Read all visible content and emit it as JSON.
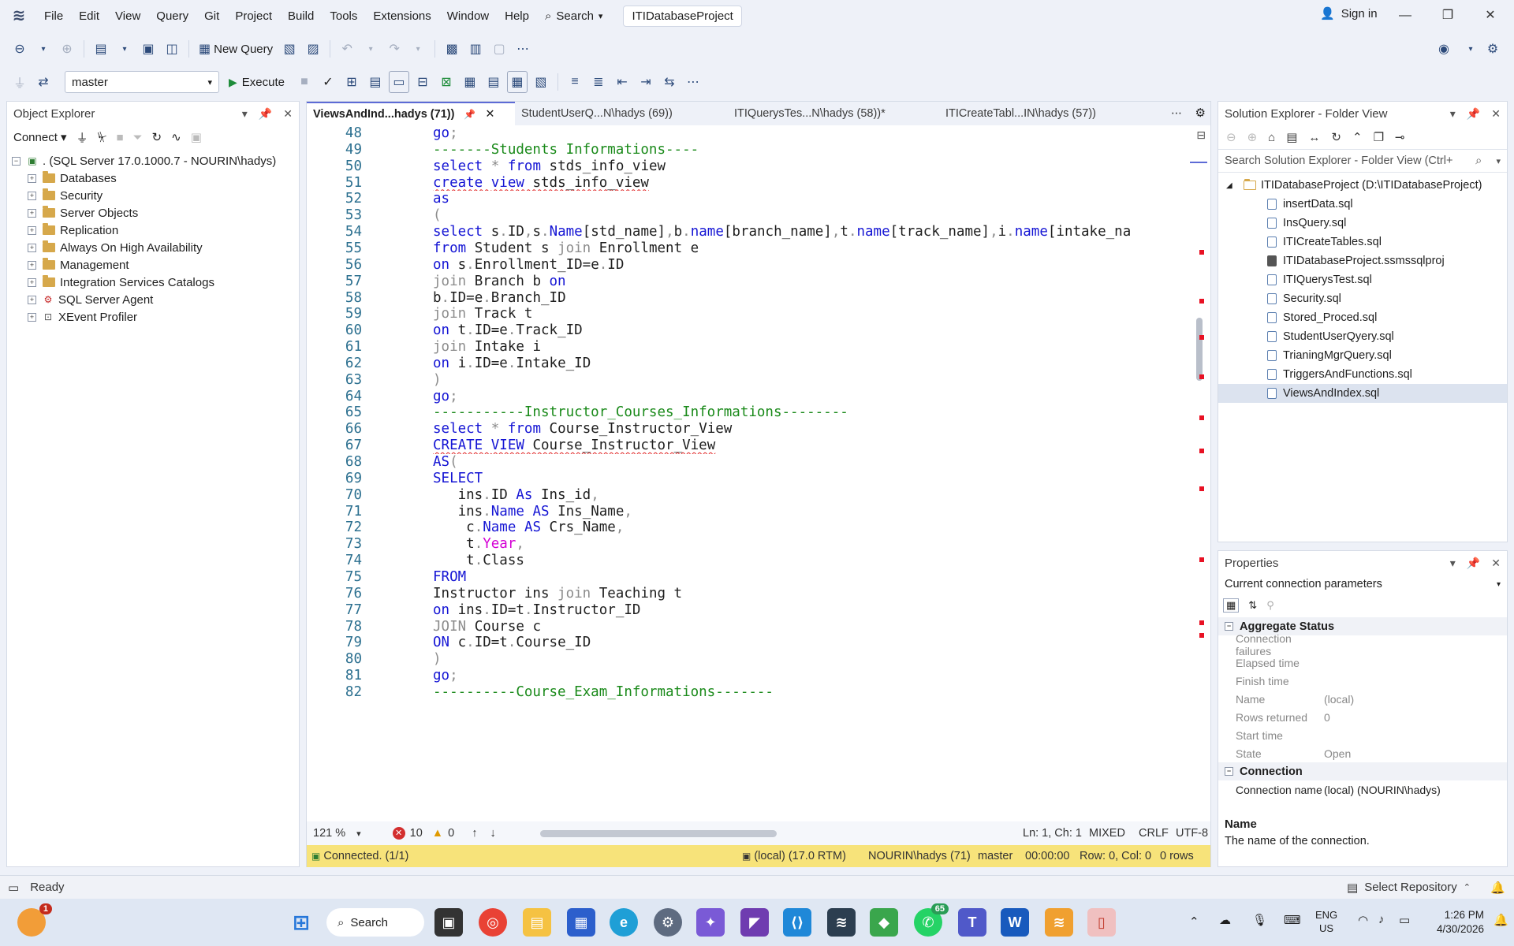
{
  "titlebar": {
    "menus": [
      "File",
      "Edit",
      "View",
      "Query",
      "Git",
      "Project",
      "Build",
      "Tools",
      "Extensions",
      "Window",
      "Help"
    ],
    "search_label": "Search",
    "project_name": "ITIDatabaseProject",
    "sign_in": "Sign in"
  },
  "toolbar": {
    "new_query": "New Query",
    "database": "master",
    "execute": "Execute"
  },
  "object_explorer": {
    "title": "Object Explorer",
    "connect": "Connect",
    "root": ". (SQL Server 17.0.1000.7 - NOURIN\\hadys)",
    "nodes": [
      "Databases",
      "Security",
      "Server Objects",
      "Replication",
      "Always On High Availability",
      "Management",
      "Integration Services Catalogs",
      "SQL Server Agent",
      "XEvent Profiler"
    ]
  },
  "tabs": [
    {
      "label": "ViewsAndInd...hadys (71))",
      "active": true
    },
    {
      "label": "StudentUserQ...N\\hadys (69))",
      "active": false
    },
    {
      "label": "ITIQuerysTes...N\\hadys (58))*",
      "active": false
    },
    {
      "label": "ITICreateTabl...IN\\hadys (57))",
      "active": false
    }
  ],
  "code_lines": [
    {
      "n": "48",
      "t": "go;"
    },
    {
      "n": "49",
      "t": "-------Students Informations----"
    },
    {
      "n": "50",
      "t": "select * from stds_info_view"
    },
    {
      "n": "51",
      "t": "create view stds_info_view"
    },
    {
      "n": "52",
      "t": "as"
    },
    {
      "n": "53",
      "t": "("
    },
    {
      "n": "54",
      "t": "select s.ID,s.Name[std_name],b.name[branch_name],t.name[track_name],i.name[intake_na"
    },
    {
      "n": "55",
      "t": "from Student s join Enrollment e"
    },
    {
      "n": "56",
      "t": "on s.Enrollment_ID=e.ID"
    },
    {
      "n": "57",
      "t": "join Branch b on"
    },
    {
      "n": "58",
      "t": "b.ID=e.Branch_ID"
    },
    {
      "n": "59",
      "t": "join Track t"
    },
    {
      "n": "60",
      "t": "on t.ID=e.Track_ID"
    },
    {
      "n": "61",
      "t": "join Intake i"
    },
    {
      "n": "62",
      "t": "on i.ID=e.Intake_ID"
    },
    {
      "n": "63",
      "t": ")"
    },
    {
      "n": "64",
      "t": "go;"
    },
    {
      "n": "65",
      "t": "-----------Instructor_Courses_Informations--------"
    },
    {
      "n": "66",
      "t": "select * from Course_Instructor_View"
    },
    {
      "n": "67",
      "t": "CREATE VIEW Course_Instructor_View"
    },
    {
      "n": "68",
      "t": "AS("
    },
    {
      "n": "69",
      "t": "SELECT"
    },
    {
      "n": "70",
      "t": "   ins.ID As Ins_id,"
    },
    {
      "n": "71",
      "t": "   ins.Name AS Ins_Name,"
    },
    {
      "n": "72",
      "t": "    c.Name AS Crs_Name,"
    },
    {
      "n": "73",
      "t": "    t.Year,"
    },
    {
      "n": "74",
      "t": "    t.Class"
    },
    {
      "n": "75",
      "t": "FROM"
    },
    {
      "n": "76",
      "t": "Instructor ins join Teaching t"
    },
    {
      "n": "77",
      "t": "on ins.ID=t.Instructor_ID"
    },
    {
      "n": "78",
      "t": "JOIN Course c"
    },
    {
      "n": "79",
      "t": "ON c.ID=t.Course_ID"
    },
    {
      "n": "80",
      "t": ")"
    },
    {
      "n": "81",
      "t": "go;"
    },
    {
      "n": "82",
      "t": "----------Course_Exam_Informations-------"
    }
  ],
  "editor_status": {
    "zoom": "121 %",
    "errors": "10",
    "warnings": "0",
    "position": "Ln: 1, Ch: 1",
    "tabs_mode": "MIXED",
    "line_ending": "CRLF",
    "encoding": "UTF-8"
  },
  "connection_bar": {
    "status": "Connected. (1/1)",
    "server": "(local) (17.0 RTM)",
    "user": "NOURIN\\hadys (71)",
    "database": "master",
    "elapsed": "00:00:00",
    "rowcol": "Row: 0, Col: 0",
    "rows": "0 rows"
  },
  "solution_explorer": {
    "title": "Solution Explorer - Folder View",
    "search_placeholder": "Search Solution Explorer - Folder View (Ctrl+",
    "project": "ITIDatabaseProject (D:\\ITIDatabaseProject)",
    "files": [
      "insertData.sql",
      "InsQuery.sql",
      "ITICreateTables.sql",
      "ITIDatabaseProject.ssmssqlproj",
      "ITIQuerysTest.sql",
      "Security.sql",
      "Stored_Proced.sql",
      "StudentUserQyery.sql",
      "TrianingMgrQuery.sql",
      "TriggersAndFunctions.sql",
      "ViewsAndIndex.sql"
    ],
    "selected": "ViewsAndIndex.sql"
  },
  "properties": {
    "title": "Properties",
    "object": "Current connection parameters",
    "categories": [
      {
        "name": "Aggregate Status",
        "rows": [
          {
            "k": "Connection failures",
            "v": ""
          },
          {
            "k": "Elapsed time",
            "v": ""
          },
          {
            "k": "Finish time",
            "v": ""
          },
          {
            "k": "Name",
            "v": "(local)"
          },
          {
            "k": "Rows returned",
            "v": "0"
          },
          {
            "k": "Start time",
            "v": ""
          },
          {
            "k": "State",
            "v": "Open"
          }
        ]
      },
      {
        "name": "Connection",
        "rows": [
          {
            "k": "Connection name",
            "v": "(local) (NOURIN\\hadys)"
          }
        ]
      }
    ],
    "desc_title": "Name",
    "desc_text": "The name of the connection."
  },
  "statusbar": {
    "ready": "Ready",
    "repo": "Select Repository"
  },
  "taskbar": {
    "search": "Search",
    "lang": "ENG",
    "region": "US",
    "time": "1:26 PM",
    "date": "4/30/2026",
    "badge_notify": "1",
    "badge_whatsapp": "65"
  },
  "colors": {
    "keyword": "#1515d4",
    "comment": "#1a8a1a",
    "function": "#d400d4",
    "conn_bar": "#f7e37a"
  }
}
